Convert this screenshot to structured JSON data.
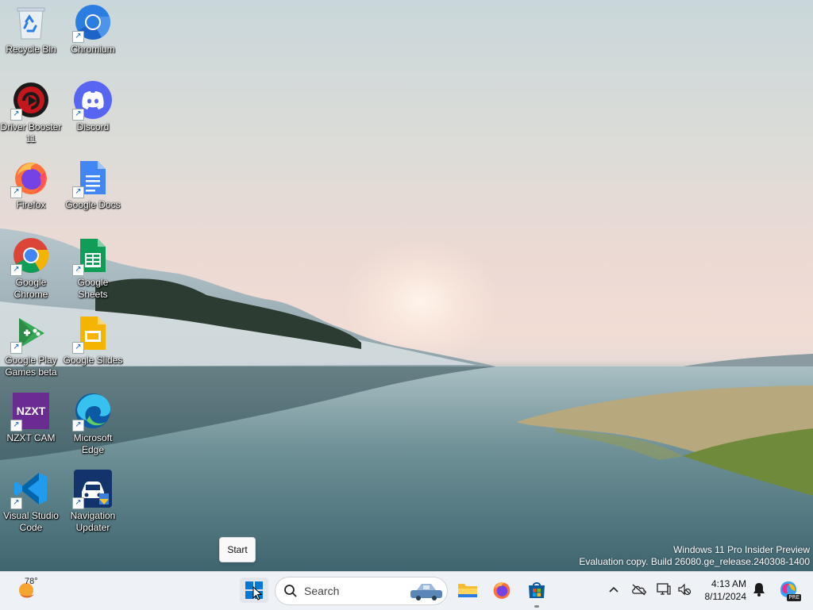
{
  "desktop_icons": [
    {
      "label": "Recycle Bin",
      "icon": "recycle-bin-icon",
      "shortcut": false
    },
    {
      "label": "Chromium",
      "icon": "chromium-icon",
      "shortcut": true
    },
    {
      "label": "Driver Booster 11",
      "icon": "driver-booster-icon",
      "shortcut": true
    },
    {
      "label": "Discord",
      "icon": "discord-icon",
      "shortcut": true
    },
    {
      "label": "Firefox",
      "icon": "firefox-icon",
      "shortcut": true
    },
    {
      "label": "Google Docs",
      "icon": "google-docs-icon",
      "shortcut": true
    },
    {
      "label": "Google Chrome",
      "icon": "google-chrome-icon",
      "shortcut": true
    },
    {
      "label": "Google Sheets",
      "icon": "google-sheets-icon",
      "shortcut": true
    },
    {
      "label": "Google Play Games beta",
      "icon": "google-play-games-icon",
      "shortcut": true
    },
    {
      "label": "Google Slides",
      "icon": "google-slides-icon",
      "shortcut": true
    },
    {
      "label": "NZXT CAM",
      "icon": "nzxt-cam-icon",
      "shortcut": true
    },
    {
      "label": "Microsoft Edge",
      "icon": "microsoft-edge-icon",
      "shortcut": true
    },
    {
      "label": "Visual Studio Code",
      "icon": "vscode-icon",
      "shortcut": true
    },
    {
      "label": "Navigation Updater",
      "icon": "navigation-updater-icon",
      "shortcut": true
    }
  ],
  "nzxt_logo_text": "NZXT",
  "watermark": {
    "line1": "Windows 11 Pro Insider Preview",
    "line2": "Evaluation copy. Build 26080.ge_release.240308-1400"
  },
  "tooltip": {
    "text": "Start"
  },
  "taskbar": {
    "weather_temp": "78°",
    "search_placeholder": "Search",
    "pinned": [
      "file-explorer-icon",
      "firefox-icon",
      "microsoft-store-icon"
    ],
    "time": "4:13 AM",
    "date": "8/11/2024",
    "copilot_badge": "PRE"
  },
  "colors": {
    "accent": "#0078d4",
    "taskbar_bg": "#eef1f5",
    "discord": "#5865f2",
    "nzxt": "#6a2c91",
    "driver_booster": "#c4161c"
  }
}
